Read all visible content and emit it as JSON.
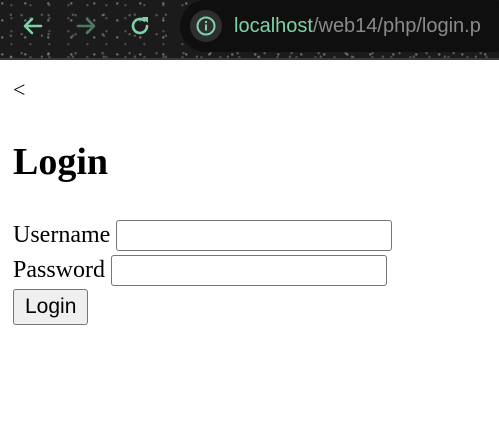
{
  "browser": {
    "address": {
      "host": "localhost",
      "path": "/web14/php/login.p"
    },
    "icons": {
      "back": "arrow-left-icon",
      "forward": "arrow-right-icon",
      "reload": "reload-icon",
      "site_info": "info-icon"
    },
    "colors": {
      "toolbar_bg": "#1b1b1b",
      "icon_active": "#7dd3a7",
      "icon_disabled": "#4f7a62",
      "url_host": "#7dd3a7",
      "url_path": "#8a8a8a"
    }
  },
  "page": {
    "back_link": "<",
    "heading": "Login",
    "form": {
      "username_label": "Username",
      "username_value": "",
      "password_label": "Password",
      "password_value": "",
      "submit_label": "Login"
    }
  }
}
